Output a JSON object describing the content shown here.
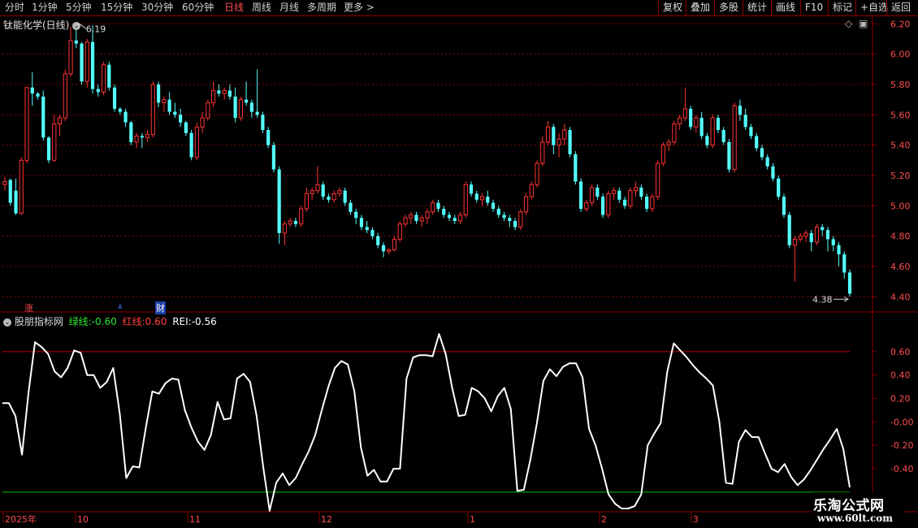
{
  "toolbar": {
    "periods": [
      "分时",
      "1分钟",
      "5分钟",
      "15分钟",
      "30分钟",
      "60分钟",
      "日线",
      "周线",
      "月线",
      "多周期",
      "更多 >"
    ],
    "active_period": "日线",
    "right_buttons": [
      "复权",
      "叠加",
      "多股",
      "统计",
      "画线",
      "F10",
      "标记",
      "+自选",
      "返回"
    ]
  },
  "main_panel": {
    "title": "钛能化学(日线)",
    "high_label": "6.19",
    "low_label": "4.38",
    "event_markers": [
      "涨",
      "财"
    ],
    "price_axis": [
      "6.20",
      "6.00",
      "5.80",
      "5.60",
      "5.40",
      "5.20",
      "5.00",
      "4.80",
      "4.60",
      "4.40"
    ]
  },
  "indicator_panel": {
    "name": "股朋指标网",
    "green_line_label": "绿线:",
    "green_line_value": "-0.60",
    "red_line_label": "红线:",
    "red_line_value": "0.60",
    "rei_label": "REI:",
    "rei_value": "-0.56",
    "axis": [
      "0.60",
      "0.40",
      "0.20",
      "-0.00",
      "-0.20",
      "-0.40"
    ]
  },
  "date_axis": [
    "2025年",
    "10",
    "11",
    "12",
    "1",
    "2",
    "3"
  ],
  "watermark": {
    "title": "乐淘公式网",
    "url": "www.60lt.com"
  },
  "colors": {
    "up": "#ff3232",
    "down": "#54ffff",
    "grid": "#8b0000",
    "rei_line": "#ffffff",
    "green_line": "#00c000",
    "red_line": "#c00000"
  },
  "chart_data": [
    {
      "type": "candlestick",
      "title": "钛能化学(日线)",
      "ylim": [
        4.3,
        6.25
      ],
      "ohlc": [
        [
          5.14,
          5.19,
          5.1,
          5.16
        ],
        [
          5.17,
          5.18,
          5.0,
          5.02
        ],
        [
          5.1,
          5.18,
          4.94,
          4.95
        ],
        [
          4.95,
          5.32,
          4.94,
          5.3
        ],
        [
          5.3,
          5.78,
          5.28,
          5.78
        ],
        [
          5.78,
          5.88,
          5.66,
          5.74
        ],
        [
          5.74,
          5.75,
          5.7,
          5.72
        ],
        [
          5.72,
          5.76,
          5.43,
          5.45
        ],
        [
          5.45,
          5.46,
          5.28,
          5.3
        ],
        [
          5.3,
          5.6,
          5.29,
          5.54
        ],
        [
          5.54,
          5.6,
          5.46,
          5.58
        ],
        [
          5.58,
          5.9,
          5.56,
          5.87
        ],
        [
          5.87,
          6.18,
          5.85,
          6.09
        ],
        [
          6.09,
          6.2,
          6.04,
          6.07
        ],
        [
          6.07,
          6.08,
          5.8,
          5.82
        ],
        [
          5.82,
          6.1,
          5.78,
          6.08
        ],
        [
          6.08,
          6.19,
          5.74,
          5.77
        ],
        [
          5.77,
          5.8,
          5.72,
          5.75
        ],
        [
          5.75,
          5.95,
          5.73,
          5.93
        ],
        [
          5.93,
          5.95,
          5.76,
          5.78
        ],
        [
          5.78,
          5.8,
          5.62,
          5.64
        ],
        [
          5.64,
          5.65,
          5.6,
          5.62
        ],
        [
          5.62,
          5.64,
          5.52,
          5.55
        ],
        [
          5.55,
          5.56,
          5.4,
          5.42
        ],
        [
          5.42,
          5.48,
          5.38,
          5.46
        ],
        [
          5.46,
          5.48,
          5.38,
          5.45
        ],
        [
          5.45,
          5.5,
          5.42,
          5.47
        ],
        [
          5.47,
          5.82,
          5.45,
          5.8
        ],
        [
          5.8,
          5.82,
          5.65,
          5.68
        ],
        [
          5.68,
          5.72,
          5.62,
          5.7
        ],
        [
          5.7,
          5.75,
          5.6,
          5.62
        ],
        [
          5.62,
          5.68,
          5.58,
          5.6
        ],
        [
          5.6,
          5.64,
          5.52,
          5.55
        ],
        [
          5.55,
          5.56,
          5.46,
          5.48
        ],
        [
          5.48,
          5.5,
          5.3,
          5.32
        ],
        [
          5.32,
          5.55,
          5.3,
          5.52
        ],
        [
          5.52,
          5.62,
          5.48,
          5.58
        ],
        [
          5.58,
          5.7,
          5.56,
          5.68
        ],
        [
          5.68,
          5.82,
          5.65,
          5.76
        ],
        [
          5.76,
          5.8,
          5.72,
          5.74
        ],
        [
          5.74,
          5.78,
          5.7,
          5.76
        ],
        [
          5.76,
          5.8,
          5.7,
          5.72
        ],
        [
          5.72,
          5.78,
          5.55,
          5.58
        ],
        [
          5.58,
          5.72,
          5.56,
          5.7
        ],
        [
          5.7,
          5.82,
          5.66,
          5.68
        ],
        [
          5.68,
          5.7,
          5.58,
          5.62
        ],
        [
          5.62,
          5.9,
          5.58,
          5.6
        ],
        [
          5.6,
          5.62,
          5.48,
          5.5
        ],
        [
          5.5,
          5.52,
          5.38,
          5.4
        ],
        [
          5.4,
          5.42,
          5.22,
          5.24
        ],
        [
          5.24,
          5.26,
          4.75,
          4.82
        ],
        [
          4.82,
          4.9,
          4.74,
          4.88
        ],
        [
          4.88,
          4.92,
          4.86,
          4.9
        ],
        [
          4.9,
          4.92,
          4.86,
          4.88
        ],
        [
          4.88,
          5.0,
          4.86,
          4.98
        ],
        [
          4.98,
          5.12,
          4.96,
          5.08
        ],
        [
          5.08,
          5.12,
          5.04,
          5.1
        ],
        [
          5.1,
          5.26,
          5.08,
          5.14
        ],
        [
          5.14,
          5.16,
          5.04,
          5.06
        ],
        [
          5.06,
          5.08,
          5.02,
          5.04
        ],
        [
          5.04,
          5.1,
          5.02,
          5.08
        ],
        [
          5.08,
          5.12,
          5.06,
          5.1
        ],
        [
          5.1,
          5.12,
          5.0,
          5.02
        ],
        [
          5.02,
          5.04,
          4.94,
          4.96
        ],
        [
          4.96,
          4.98,
          4.88,
          4.92
        ],
        [
          4.92,
          4.94,
          4.84,
          4.86
        ],
        [
          4.86,
          4.9,
          4.82,
          4.84
        ],
        [
          4.84,
          4.86,
          4.78,
          4.8
        ],
        [
          4.8,
          4.82,
          4.72,
          4.74
        ],
        [
          4.74,
          4.76,
          4.66,
          4.7
        ],
        [
          4.7,
          4.72,
          4.68,
          4.71
        ],
        [
          4.71,
          4.8,
          4.7,
          4.78
        ],
        [
          4.78,
          4.9,
          4.76,
          4.88
        ],
        [
          4.88,
          4.94,
          4.86,
          4.92
        ],
        [
          4.92,
          4.96,
          4.88,
          4.94
        ],
        [
          4.94,
          4.96,
          4.88,
          4.9
        ],
        [
          4.9,
          4.94,
          4.86,
          4.92
        ],
        [
          4.92,
          4.98,
          4.88,
          4.96
        ],
        [
          4.96,
          5.04,
          4.94,
          5.02
        ],
        [
          5.02,
          5.04,
          4.96,
          4.98
        ],
        [
          4.98,
          5.0,
          4.92,
          4.94
        ],
        [
          4.94,
          4.96,
          4.9,
          4.92
        ],
        [
          4.92,
          4.94,
          4.88,
          4.9
        ],
        [
          4.9,
          4.96,
          4.88,
          4.94
        ],
        [
          4.94,
          5.16,
          4.92,
          5.14
        ],
        [
          5.14,
          5.16,
          5.06,
          5.08
        ],
        [
          5.08,
          5.1,
          5.02,
          5.04
        ],
        [
          5.04,
          5.08,
          5.0,
          5.06
        ],
        [
          5.06,
          5.1,
          5.0,
          5.02
        ],
        [
          5.02,
          5.04,
          4.96,
          4.98
        ],
        [
          4.98,
          5.0,
          4.92,
          4.94
        ],
        [
          4.94,
          4.96,
          4.9,
          4.92
        ],
        [
          4.92,
          4.94,
          4.86,
          4.9
        ],
        [
          4.9,
          4.92,
          4.84,
          4.86
        ],
        [
          4.86,
          4.98,
          4.84,
          4.96
        ],
        [
          4.96,
          5.08,
          4.94,
          5.06
        ],
        [
          5.06,
          5.16,
          5.04,
          5.14
        ],
        [
          5.14,
          5.3,
          5.12,
          5.28
        ],
        [
          5.28,
          5.46,
          5.26,
          5.42
        ],
        [
          5.42,
          5.56,
          5.4,
          5.52
        ],
        [
          5.52,
          5.54,
          5.34,
          5.4
        ],
        [
          5.4,
          5.48,
          5.32,
          5.44
        ],
        [
          5.44,
          5.54,
          5.4,
          5.5
        ],
        [
          5.5,
          5.52,
          5.32,
          5.34
        ],
        [
          5.34,
          5.36,
          5.14,
          5.16
        ],
        [
          5.16,
          5.18,
          4.96,
          4.98
        ],
        [
          4.98,
          5.04,
          4.96,
          5.02
        ],
        [
          5.02,
          5.14,
          5.0,
          5.12
        ],
        [
          5.12,
          5.14,
          5.04,
          5.06
        ],
        [
          5.06,
          5.08,
          4.92,
          4.94
        ],
        [
          4.94,
          5.1,
          4.92,
          5.08
        ],
        [
          5.08,
          5.12,
          5.04,
          5.1
        ],
        [
          5.1,
          5.12,
          5.02,
          5.04
        ],
        [
          5.04,
          5.06,
          4.98,
          5.0
        ],
        [
          5.0,
          5.12,
          4.98,
          5.1
        ],
        [
          5.1,
          5.16,
          5.06,
          5.12
        ],
        [
          5.12,
          5.14,
          5.04,
          5.06
        ],
        [
          5.06,
          5.08,
          4.96,
          4.98
        ],
        [
          4.98,
          5.08,
          4.96,
          5.06
        ],
        [
          5.06,
          5.3,
          5.04,
          5.28
        ],
        [
          5.28,
          5.42,
          5.26,
          5.4
        ],
        [
          5.4,
          5.44,
          5.36,
          5.42
        ],
        [
          5.42,
          5.56,
          5.4,
          5.54
        ],
        [
          5.54,
          5.6,
          5.5,
          5.58
        ],
        [
          5.58,
          5.78,
          5.56,
          5.64
        ],
        [
          5.64,
          5.66,
          5.5,
          5.52
        ],
        [
          5.52,
          5.6,
          5.48,
          5.58
        ],
        [
          5.58,
          5.62,
          5.44,
          5.46
        ],
        [
          5.46,
          5.48,
          5.38,
          5.4
        ],
        [
          5.4,
          5.6,
          5.38,
          5.58
        ],
        [
          5.58,
          5.6,
          5.48,
          5.5
        ],
        [
          5.5,
          5.52,
          5.4,
          5.42
        ],
        [
          5.42,
          5.44,
          5.22,
          5.24
        ],
        [
          5.24,
          5.68,
          5.22,
          5.66
        ],
        [
          5.66,
          5.7,
          5.56,
          5.6
        ],
        [
          5.6,
          5.64,
          5.5,
          5.52
        ],
        [
          5.52,
          5.54,
          5.44,
          5.46
        ],
        [
          5.46,
          5.48,
          5.36,
          5.38
        ],
        [
          5.38,
          5.4,
          5.3,
          5.32
        ],
        [
          5.32,
          5.34,
          5.24,
          5.26
        ],
        [
          5.26,
          5.28,
          5.16,
          5.18
        ],
        [
          5.18,
          5.2,
          5.04,
          5.06
        ],
        [
          5.06,
          5.08,
          4.92,
          4.94
        ],
        [
          4.94,
          4.96,
          4.72,
          4.74
        ],
        [
          4.74,
          4.8,
          4.5,
          4.78
        ],
        [
          4.78,
          4.82,
          4.76,
          4.8
        ],
        [
          4.8,
          4.84,
          4.76,
          4.82
        ],
        [
          4.82,
          4.84,
          4.7,
          4.76
        ],
        [
          4.76,
          4.88,
          4.74,
          4.86
        ],
        [
          4.86,
          4.88,
          4.8,
          4.84
        ],
        [
          4.84,
          4.86,
          4.7,
          4.78
        ],
        [
          4.78,
          4.8,
          4.7,
          4.74
        ],
        [
          4.74,
          4.76,
          4.6,
          4.68
        ],
        [
          4.68,
          4.7,
          4.52,
          4.56
        ],
        [
          4.56,
          4.58,
          4.4,
          4.42
        ]
      ]
    },
    {
      "type": "line",
      "title": "股朋指标网",
      "ylim": [
        -0.74,
        0.8
      ],
      "series": [
        {
          "name": "REI",
          "values": [
            0.16,
            0.16,
            0.05,
            -0.28,
            0.25,
            0.68,
            0.64,
            0.58,
            0.43,
            0.38,
            0.46,
            0.61,
            0.59,
            0.4,
            0.4,
            0.29,
            0.34,
            0.46,
            0.07,
            -0.48,
            -0.38,
            -0.39,
            -0.05,
            0.26,
            0.24,
            0.33,
            0.37,
            0.36,
            0.1,
            -0.05,
            -0.17,
            -0.24,
            -0.11,
            0.17,
            0.02,
            0.03,
            0.37,
            0.41,
            0.34,
            0.05,
            -0.38,
            -0.76,
            -0.52,
            -0.44,
            -0.54,
            -0.48,
            -0.36,
            -0.25,
            -0.11,
            0.1,
            0.3,
            0.46,
            0.52,
            0.49,
            0.26,
            -0.22,
            -0.46,
            -0.41,
            -0.51,
            -0.51,
            -0.4,
            -0.4,
            0.37,
            0.55,
            0.57,
            0.57,
            0.56,
            0.75,
            0.58,
            0.29,
            0.05,
            0.06,
            0.29,
            0.26,
            0.2,
            0.09,
            0.22,
            0.29,
            0.11,
            -0.59,
            -0.58,
            -0.32,
            -0.01,
            0.35,
            0.45,
            0.39,
            0.47,
            0.5,
            0.5,
            0.38,
            -0.06,
            -0.2,
            -0.4,
            -0.62,
            -0.7,
            -0.74,
            -0.74,
            -0.72,
            -0.62,
            -0.2,
            -0.1,
            -0.01,
            0.43,
            0.67,
            0.61,
            0.55,
            0.48,
            0.42,
            0.37,
            0.31,
            0.0,
            -0.52,
            -0.53,
            -0.17,
            -0.07,
            -0.13,
            -0.13,
            -0.27,
            -0.4,
            -0.43,
            -0.36,
            -0.47,
            -0.54,
            -0.49,
            -0.41,
            -0.32,
            -0.23,
            -0.15,
            -0.06,
            -0.23,
            -0.56
          ]
        },
        {
          "name": "绿线",
          "values": [
            -0.6
          ]
        },
        {
          "name": "红线",
          "values": [
            0.6
          ]
        }
      ]
    }
  ]
}
